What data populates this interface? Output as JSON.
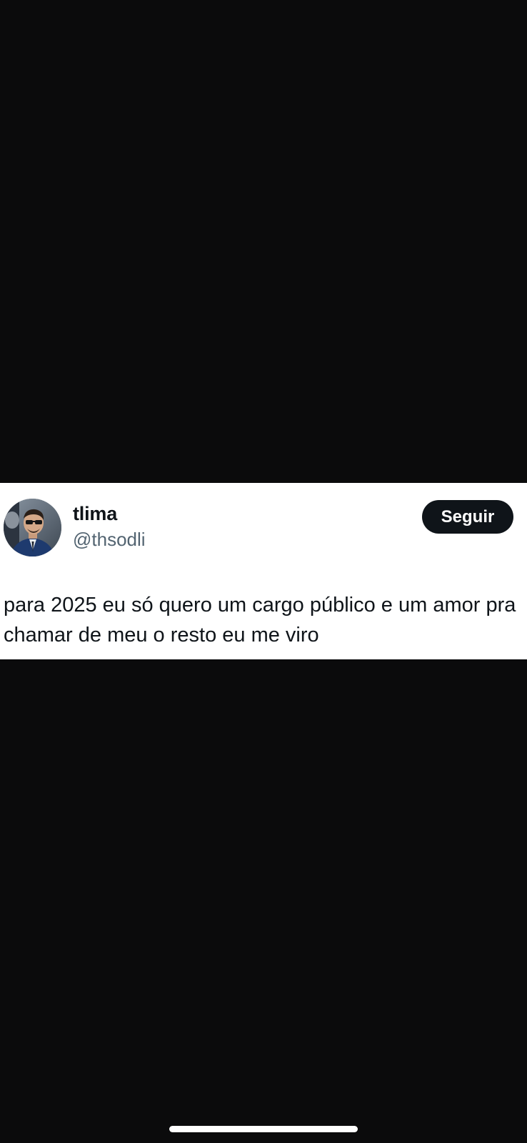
{
  "tweet": {
    "display_name": "tlima",
    "handle": "@thsodli",
    "follow_label": "Seguir",
    "text": "para 2025 eu só quero um cargo público e um amor pra chamar de meu o resto eu me viro",
    "avatar_icon": "profile-photo"
  },
  "colors": {
    "background": "#0b0b0c",
    "card": "#ffffff",
    "text_primary": "#0f1419",
    "text_secondary": "#536471",
    "button": "#0f1419"
  }
}
